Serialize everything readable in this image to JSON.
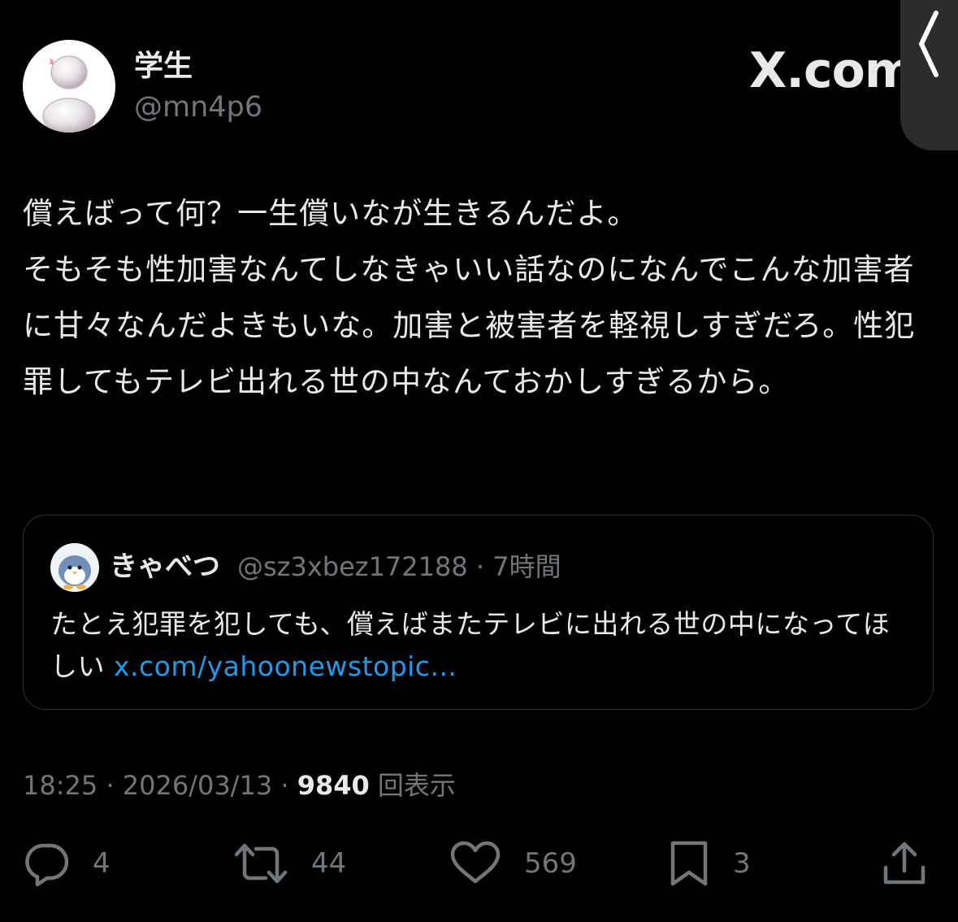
{
  "header": {
    "display_name": "学生",
    "handle": "@mn4p6",
    "source_logo": "X.com"
  },
  "tweet": {
    "text": "償えばって何？一生償いなが生きるんだよ。\nそもそも性加害なんてしなきゃいい話なのになんでこんな加害者に甘々なんだよきもいな。加害と被害者を軽視しすぎだろ。性犯罪してもテレビ出れる世の中なんておかしすぎるから。"
  },
  "quote": {
    "display_name": "きゃべつ",
    "meta": "@sz3xbez172188 · 7時間",
    "text": "たとえ犯罪を犯しても、償えばまたテレビに出れる世の中になってほしい ",
    "link": "x.com/yahoonewstopic..."
  },
  "meta": {
    "time": "18:25",
    "separator": " · ",
    "date": "2026/03/13",
    "views": "9840",
    "views_label": " 回表示"
  },
  "actions": {
    "replies": "4",
    "retweets": "44",
    "likes": "569",
    "bookmarks": "3"
  },
  "icons": {
    "reply": "reply-icon",
    "retweet": "retweet-icon",
    "like": "heart-icon",
    "bookmark": "bookmark-icon",
    "share": "share-icon",
    "side_tab": "chevron-left-icon"
  },
  "colors": {
    "background": "#000000",
    "text": "#e7e9ea",
    "muted": "#71767b",
    "link": "#1d9bf0",
    "border": "#2f3336"
  }
}
